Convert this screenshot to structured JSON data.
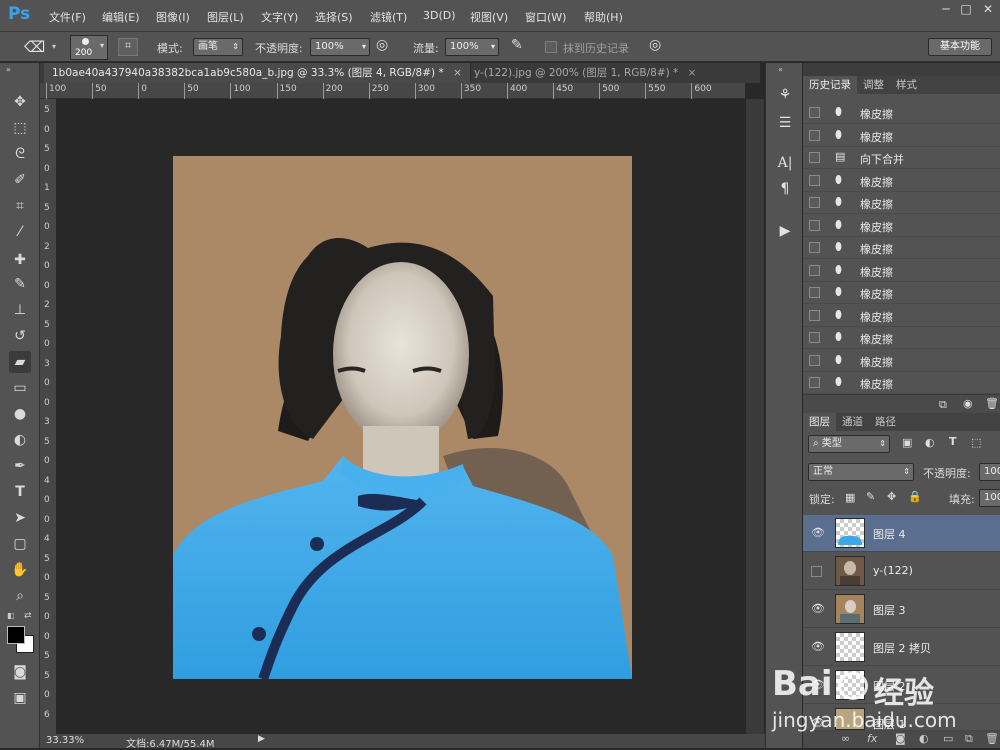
{
  "app": {
    "logo": "Ps"
  },
  "menu": [
    "文件(F)",
    "编辑(E)",
    "图像(I)",
    "图层(L)",
    "文字(Y)",
    "选择(S)",
    "滤镜(T)",
    "3D(D)",
    "视图(V)",
    "窗口(W)",
    "帮助(H)"
  ],
  "window_controls": [
    "─",
    "□",
    "✕"
  ],
  "options": {
    "brush_size": "200",
    "mode_label": "模式:",
    "mode_value": "画笔",
    "opacity_label": "不透明度:",
    "opacity_value": "100%",
    "flow_label": "流量:",
    "flow_value": "100%",
    "erase_history_label": "抹到历史记录",
    "workspace": "基本功能"
  },
  "tabs": [
    {
      "label": "1b0ae40a437940a38382bca1ab9c580a_b.jpg @ 33.3% (图层 4, RGB/8#) *",
      "active": true
    },
    {
      "label": "y-(122).jpg @ 200% (图层 1, RGB/8#) *",
      "active": false
    }
  ],
  "ruler_top": [
    "100",
    "50",
    "0",
    "50",
    "100",
    "150",
    "200",
    "250",
    "300",
    "350",
    "400",
    "450",
    "500",
    "550",
    "600"
  ],
  "ruler_left": [
    "5",
    "0",
    "5",
    "0",
    "1",
    "5",
    "0",
    "2",
    "0",
    "0",
    "2",
    "5",
    "0",
    "3",
    "0",
    "0",
    "3",
    "5",
    "0",
    "4",
    "0",
    "0",
    "4",
    "5",
    "0",
    "5",
    "0",
    "0",
    "5",
    "5",
    "0",
    "6"
  ],
  "status": {
    "zoom": "33.33%",
    "doc": "文档:6.47M/55.4M"
  },
  "history_panel": {
    "tabs": [
      "历史记录",
      "调整",
      "样式"
    ],
    "items": [
      "橡皮擦",
      "橡皮擦",
      "向下合并",
      "橡皮擦",
      "橡皮擦",
      "橡皮擦",
      "橡皮擦",
      "橡皮擦",
      "橡皮擦",
      "橡皮擦",
      "橡皮擦",
      "橡皮擦",
      "橡皮擦"
    ]
  },
  "layers_panel": {
    "tabs": [
      "图层",
      "通道",
      "路径"
    ],
    "filter": "类型",
    "blend_mode": "正常",
    "opacity_label": "不透明度:",
    "opacity_value": "100",
    "lock_label": "锁定:",
    "fill_label": "填充:",
    "fill_value": "100",
    "layers": [
      "图层 4",
      "y-(122)",
      "图层 3",
      "图层 2 拷贝",
      "图层 2",
      "图层 1"
    ]
  },
  "watermark": {
    "brand": "Bai",
    "brand2": "经验",
    "url": "jingyan.baidu.com"
  },
  "colors": {
    "accent": "#3aa3e8",
    "selected_layer": "#5a6f8e",
    "photo_bg": "#ab8966",
    "dress": "#3da8e6"
  }
}
